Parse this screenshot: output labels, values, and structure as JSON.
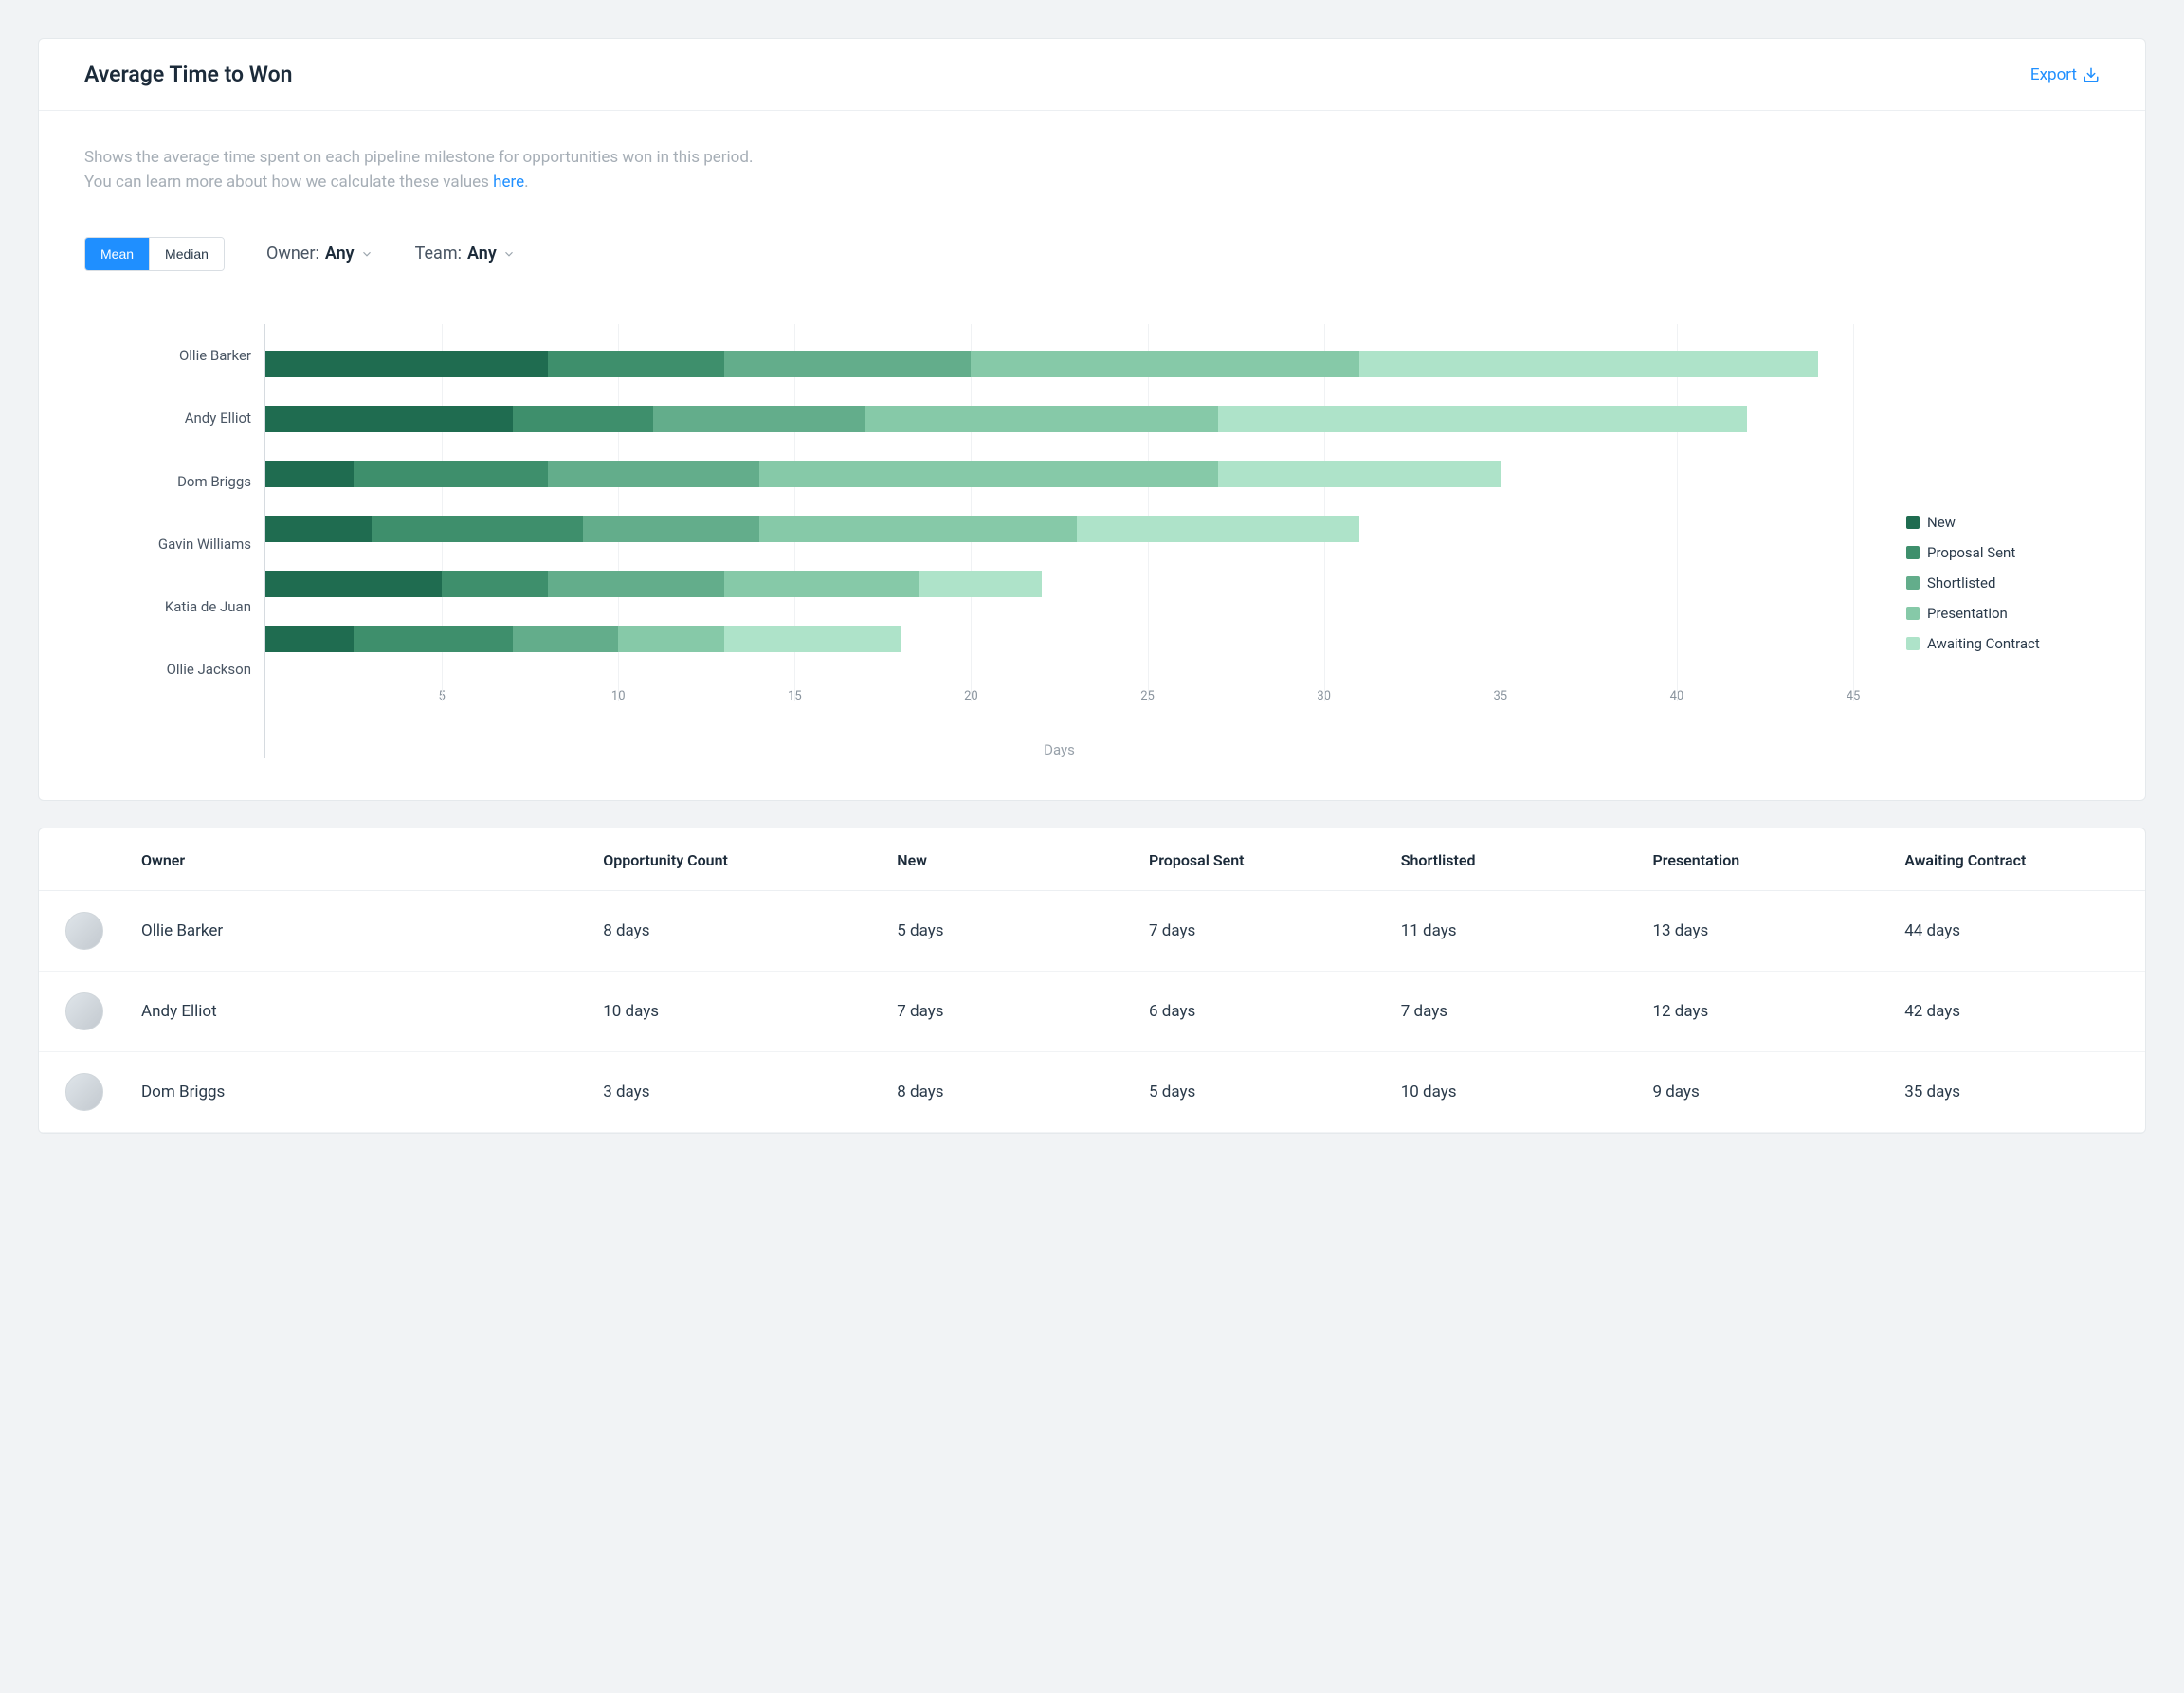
{
  "header": {
    "title": "Average Time to Won",
    "export_label": "Export"
  },
  "description": {
    "line1": "Shows the average time spent on each pipeline milestone for opportunities won in this period.",
    "line2_prefix": "You can learn more about how we calculate these values ",
    "line2_link": "here",
    "line2_suffix": "."
  },
  "controls": {
    "mean_label": "Mean",
    "median_label": "Median",
    "owner_label": "Owner: ",
    "owner_value": "Any",
    "team_label": "Team: ",
    "team_value": "Any"
  },
  "legend": {
    "items": [
      {
        "name": "New",
        "color": "#1f6c50"
      },
      {
        "name": "Proposal Sent",
        "color": "#3e8f6c"
      },
      {
        "name": "Shortlisted",
        "color": "#63ad8b"
      },
      {
        "name": "Presentation",
        "color": "#86c9a8"
      },
      {
        "name": "Awaiting Contract",
        "color": "#aee3c9"
      }
    ]
  },
  "chart_data": {
    "type": "bar",
    "orientation": "horizontal",
    "stacked": true,
    "xlabel": "Days",
    "xlim": [
      0,
      45
    ],
    "xticks": [
      5,
      10,
      15,
      20,
      25,
      30,
      35,
      40,
      45
    ],
    "categories": [
      "Ollie Barker",
      "Andy Elliot",
      "Dom Briggs",
      "Gavin Williams",
      "Katia de Juan",
      "Ollie Jackson"
    ],
    "series": [
      {
        "name": "New",
        "color": "#1f6c50",
        "values": [
          8,
          7,
          2.5,
          3,
          5,
          2.5
        ]
      },
      {
        "name": "Proposal Sent",
        "color": "#3e8f6c",
        "values": [
          5,
          4,
          5.5,
          6,
          3,
          4.5
        ]
      },
      {
        "name": "Shortlisted",
        "color": "#63ad8b",
        "values": [
          7,
          6,
          6,
          5,
          5,
          3
        ]
      },
      {
        "name": "Presentation",
        "color": "#86c9a8",
        "values": [
          11,
          10,
          13,
          9,
          5.5,
          3
        ]
      },
      {
        "name": "Awaiting Contract",
        "color": "#aee3c9",
        "values": [
          13,
          15,
          8,
          8,
          3.5,
          5
        ]
      }
    ]
  },
  "table": {
    "columns": [
      "",
      "Owner",
      "Opportunity Count",
      "New",
      "Proposal Sent",
      "Shortlisted",
      "Presentation",
      "Awaiting Contract"
    ],
    "rows": [
      {
        "owner": "Ollie Barker",
        "opportunity_count": "8 days",
        "new": "5 days",
        "proposal_sent": "7 days",
        "shortlisted": "11 days",
        "presentation": "13 days",
        "awaiting_contract": "44 days"
      },
      {
        "owner": "Andy Elliot",
        "opportunity_count": "10 days",
        "new": "7 days",
        "proposal_sent": "6 days",
        "shortlisted": "7 days",
        "presentation": "12 days",
        "awaiting_contract": "42 days"
      },
      {
        "owner": "Dom Briggs",
        "opportunity_count": "3 days",
        "new": "8 days",
        "proposal_sent": "5 days",
        "shortlisted": "10 days",
        "presentation": "9 days",
        "awaiting_contract": "35 days"
      }
    ]
  }
}
